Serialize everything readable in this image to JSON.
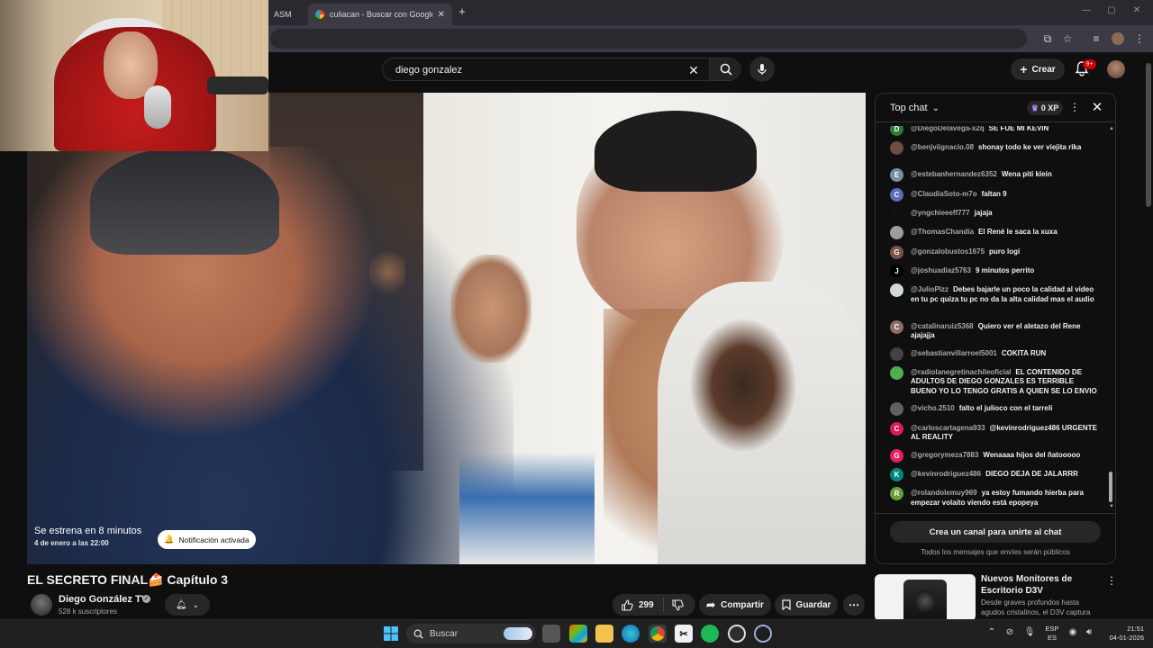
{
  "browser": {
    "tabs": [
      {
        "label": "ASM"
      },
      {
        "label": "culiacan - Buscar con Google"
      }
    ],
    "new_tab_label": "+"
  },
  "header": {
    "search_query": "diego gonzalez",
    "create_label": "Crear",
    "notification_count": "9+"
  },
  "video": {
    "premiere_title": "Se estrena en 8 minutos",
    "premiere_date": "4 de enero a las 22:00",
    "notification_pill": "Notificación activada",
    "title": "EL SECRETO FINAL🍰 Capítulo 3",
    "channel_name": "Diego González TV",
    "subscribers": "528 k suscriptores",
    "like_count": "299",
    "share_label": "Compartir",
    "save_label": "Guardar"
  },
  "chat": {
    "title": "Top chat",
    "xp": "0 XP",
    "messages": [
      {
        "avatar": "D",
        "color": "#2e7d32",
        "author": "@DiegoDelavega-x2q",
        "text": "SE FUE MI KEVIN"
      },
      {
        "avatar": "",
        "color": "#6d4c41",
        "author": "@benjviignacio.08",
        "text": "shonay todo ke ver viejita rika"
      },
      {
        "avatar": "E",
        "color": "#78909c",
        "author": "@estebanhernandez6352",
        "text": "Wena piti klein"
      },
      {
        "avatar": "C",
        "color": "#5c6bc0",
        "author": "@ClaudiaSoto-m7o",
        "text": "faltan 9"
      },
      {
        "avatar": "",
        "color": "#111111",
        "author": "@yngchieeeff777",
        "text": "jajaja"
      },
      {
        "avatar": "",
        "color": "#9e9e9e",
        "author": "@ThomasChandia",
        "text": "El René le saca la xuxa"
      },
      {
        "avatar": "G",
        "color": "#795548",
        "author": "@gonzalobustos1675",
        "text": "puro logi"
      },
      {
        "avatar": "J",
        "color": "#000000",
        "author": "@joshuadiaz5763",
        "text": "9 minutos perrito"
      },
      {
        "avatar": "",
        "color": "#cfd8dc",
        "author": "@JulioPlzz",
        "text": "Debes bajarle un poco la calidad al video en tu pc quiza tu pc no da la alta calidad mas el audio"
      },
      {
        "avatar": "C",
        "color": "#8d6e63",
        "author": "@catalinaruiz5368",
        "text": "Quiero ver el aletazo del Rene ajajajja"
      },
      {
        "avatar": "",
        "color": "#424242",
        "author": "@sebastianvillarroel5001",
        "text": "COKITA RUN"
      },
      {
        "avatar": "",
        "color": "#4caf50",
        "author": "@radiolanegretinachileoficial",
        "text": "EL CONTENIDO DE ADULTOS DE DIEGO GONZALES ES TERRIBLE BUENO YO LO TENGO GRATIS A QUIEN SE LO ENVIO"
      },
      {
        "avatar": "",
        "color": "#616161",
        "author": "@vicho.2510",
        "text": "falto el julioco con el tarreli"
      },
      {
        "avatar": "C",
        "color": "#d81b60",
        "author": "@carloscartagena933",
        "text": "@kevinrodriguez486 URGENTE AL REALITY"
      },
      {
        "avatar": "G",
        "color": "#e91e63",
        "author": "@gregorymeza7883",
        "text": "Wenaaaa hijos del ñatooooo"
      },
      {
        "avatar": "K",
        "color": "#00897b",
        "author": "@kevinrodriguez486",
        "text": "DIEGO DEJA DE JALARRR"
      },
      {
        "avatar": "R",
        "color": "#689f38",
        "author": "@rolandolemuy969",
        "text": "ya estoy fumando hierba para empezar volaito viendo está epopeya"
      }
    ],
    "join_label": "Crea un canal para unirte al chat",
    "note": "Todos los mensajes que envíes serán públicos"
  },
  "recommended": {
    "title": "Nuevos Monitores de Escritorio D3V",
    "desc": "Desde graves profundos hasta agudos cristalinos, el D3V captura"
  },
  "taskbar": {
    "search_label": "Buscar",
    "lang_line1": "ESP",
    "lang_line2": "ES",
    "time": "21:51",
    "date": "04-01-2026"
  }
}
